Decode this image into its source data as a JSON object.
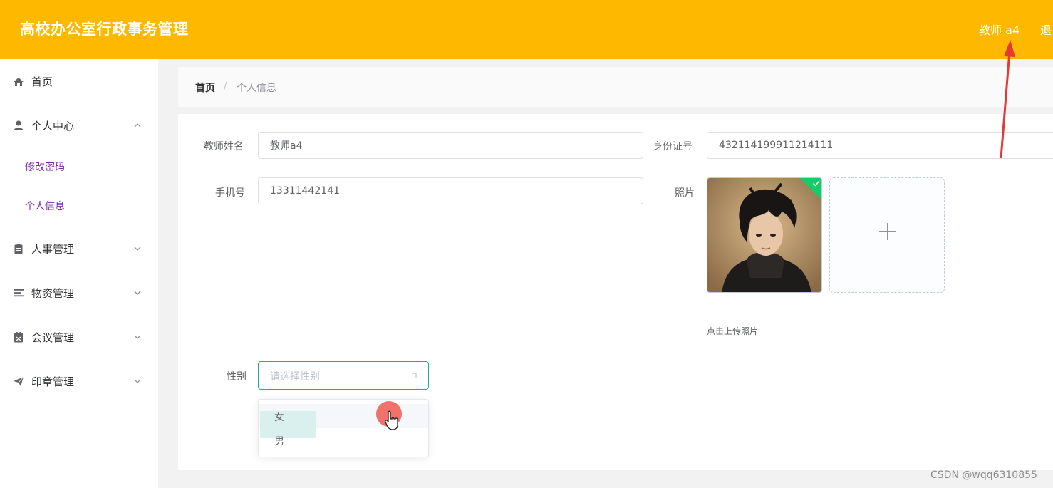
{
  "header": {
    "app_title": "高校办公室行政事务管理",
    "user_name": "教师 a4",
    "logout_label": "退"
  },
  "sidebar": {
    "items": [
      {
        "label": "首页",
        "icon": "home-icon"
      },
      {
        "label": "个人中心",
        "icon": "user-icon",
        "expanded": true,
        "children": [
          {
            "label": "修改密码"
          },
          {
            "label": "个人信息"
          }
        ]
      },
      {
        "label": "人事管理",
        "icon": "clipboard-icon"
      },
      {
        "label": "物资管理",
        "icon": "list-icon"
      },
      {
        "label": "会议管理",
        "icon": "calendar-icon"
      },
      {
        "label": "印章管理",
        "icon": "send-icon"
      }
    ]
  },
  "breadcrumb": {
    "home": "首页",
    "separator": "/",
    "current": "个人信息"
  },
  "form": {
    "name_label": "教师姓名",
    "name_value": "教师a4",
    "id_label": "身份证号",
    "id_value": "432114199911214111",
    "phone_label": "手机号",
    "phone_value": "13311442141",
    "photo_label": "照片",
    "upload_tip": "点击上传照片",
    "gender_label": "性别",
    "gender_placeholder": "请选择性别",
    "gender_options": [
      "女",
      "男"
    ]
  },
  "watermark": "CSDN @wqq6310855",
  "colors": {
    "header_bg": "#ffb800",
    "submenu_text": "#7b2ca5",
    "select_border": "#26a8a0",
    "upload_success": "#13ce66",
    "annotation_arrow": "#e53935"
  }
}
